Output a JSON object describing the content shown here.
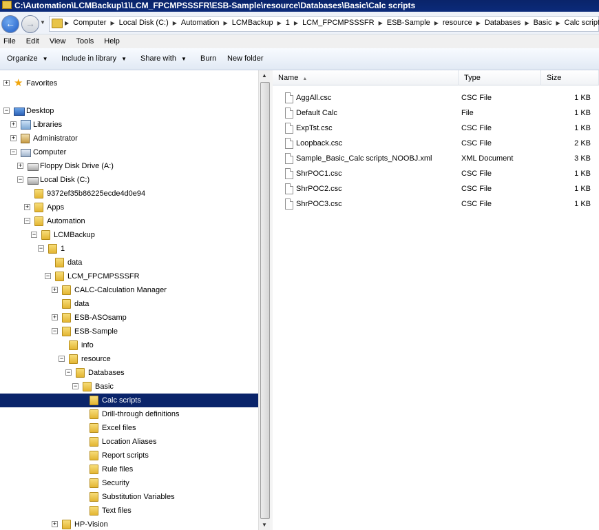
{
  "window": {
    "title": "C:\\Automation\\LCMBackup\\1\\LCM_FPCMPSSSFR\\ESB-Sample\\resource\\Databases\\Basic\\Calc scripts"
  },
  "address": {
    "crumbs": [
      "Computer",
      "Local Disk (C:)",
      "Automation",
      "LCMBackup",
      "1",
      "LCM_FPCMPSSSFR",
      "ESB-Sample",
      "resource",
      "Databases",
      "Basic",
      "Calc scripts"
    ]
  },
  "menu": {
    "items": [
      "File",
      "Edit",
      "View",
      "Tools",
      "Help"
    ]
  },
  "toolbar": {
    "organize": "Organize",
    "include": "Include in library",
    "share": "Share with",
    "burn": "Burn",
    "new_folder": "New folder"
  },
  "tree": {
    "items": [
      {
        "label": "Favorites",
        "icon": "star-icon",
        "expander": "+"
      },
      {
        "label": "Desktop",
        "icon": "desktop-icon",
        "expander": "−"
      },
      {
        "label": "Libraries",
        "icon": "libraries-icon",
        "expander": "+"
      },
      {
        "label": "Administrator",
        "icon": "user-folder-icon",
        "expander": "+"
      },
      {
        "label": "Computer",
        "icon": "computer-icon",
        "expander": "−"
      },
      {
        "label": "Floppy Disk Drive (A:)",
        "icon": "floppy-drive-icon",
        "expander": "+"
      },
      {
        "label": "Local Disk (C:)",
        "icon": "local-disk-icon",
        "expander": "−"
      },
      {
        "label": "9372ef35b86225ecde4d0e94",
        "icon": "folder-icon",
        "expander": ""
      },
      {
        "label": "Apps",
        "icon": "folder-icon",
        "expander": "+"
      },
      {
        "label": "Automation",
        "icon": "folder-icon",
        "expander": "−"
      },
      {
        "label": "LCMBackup",
        "icon": "folder-icon",
        "expander": "−"
      },
      {
        "label": "1",
        "icon": "folder-icon",
        "expander": "−"
      },
      {
        "label": "data",
        "icon": "folder-icon",
        "expander": ""
      },
      {
        "label": "LCM_FPCMPSSSFR",
        "icon": "folder-icon",
        "expander": "−"
      },
      {
        "label": "CALC-Calculation Manager",
        "icon": "folder-icon",
        "expander": "+"
      },
      {
        "label": "data",
        "icon": "folder-icon",
        "expander": ""
      },
      {
        "label": "ESB-ASOsamp",
        "icon": "folder-icon",
        "expander": "+"
      },
      {
        "label": "ESB-Sample",
        "icon": "folder-icon",
        "expander": "−"
      },
      {
        "label": "info",
        "icon": "folder-icon",
        "expander": ""
      },
      {
        "label": "resource",
        "icon": "folder-icon",
        "expander": "−"
      },
      {
        "label": "Databases",
        "icon": "folder-icon",
        "expander": "−"
      },
      {
        "label": "Basic",
        "icon": "folder-icon",
        "expander": "−"
      },
      {
        "label": "Calc scripts",
        "icon": "folder-icon",
        "expander": "",
        "selected": true
      },
      {
        "label": "Drill-through definitions",
        "icon": "folder-icon",
        "expander": ""
      },
      {
        "label": "Excel files",
        "icon": "folder-icon",
        "expander": ""
      },
      {
        "label": "Location Aliases",
        "icon": "folder-icon",
        "expander": ""
      },
      {
        "label": "Report scripts",
        "icon": "folder-icon",
        "expander": ""
      },
      {
        "label": "Rule files",
        "icon": "folder-icon",
        "expander": ""
      },
      {
        "label": "Security",
        "icon": "folder-icon",
        "expander": ""
      },
      {
        "label": "Substitution Variables",
        "icon": "folder-icon",
        "expander": ""
      },
      {
        "label": "Text files",
        "icon": "folder-icon",
        "expander": ""
      },
      {
        "label": "HP-Vision",
        "icon": "folder-icon",
        "expander": "+"
      }
    ]
  },
  "files": {
    "columns": [
      "Name",
      "Type",
      "Size"
    ],
    "rows": [
      {
        "name": "AggAll.csc",
        "type": "CSC File",
        "size": "1 KB"
      },
      {
        "name": "Default Calc",
        "type": "File",
        "size": "1 KB"
      },
      {
        "name": "ExpTst.csc",
        "type": "CSC File",
        "size": "1 KB"
      },
      {
        "name": "Loopback.csc",
        "type": "CSC File",
        "size": "2 KB"
      },
      {
        "name": "Sample_Basic_Calc scripts_NOOBJ.xml",
        "type": "XML Document",
        "size": "3 KB"
      },
      {
        "name": "ShrPOC1.csc",
        "type": "CSC File",
        "size": "1 KB"
      },
      {
        "name": "ShrPOC2.csc",
        "type": "CSC File",
        "size": "1 KB"
      },
      {
        "name": "ShrPOC3.csc",
        "type": "CSC File",
        "size": "1 KB"
      }
    ]
  }
}
